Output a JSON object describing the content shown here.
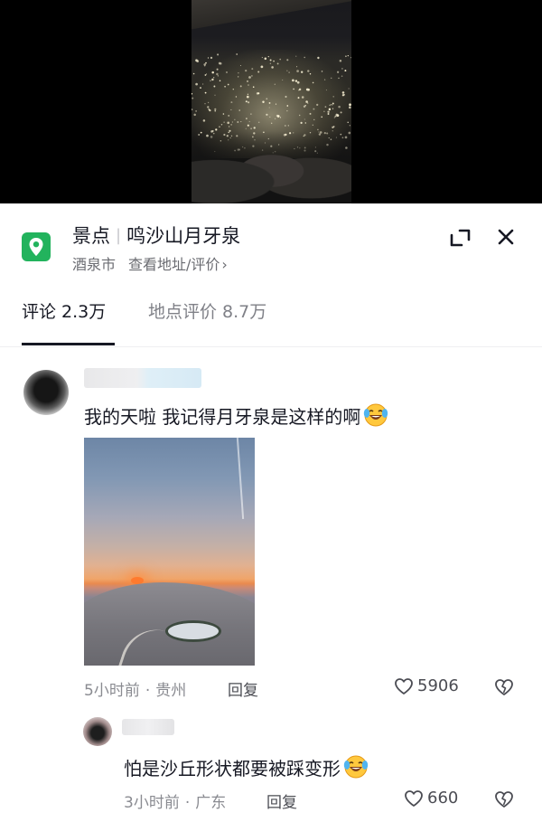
{
  "location": {
    "category": "景点",
    "name": "鸣沙山月牙泉",
    "city": "酒泉市",
    "link": "查看地址/评价",
    "chevron": "›"
  },
  "icons": {
    "location": "map-pin-icon",
    "expand": "expand-icon",
    "close": "close-icon",
    "like": "heart-outline-icon",
    "dislike": "broken-heart-icon",
    "emoji": "laughing-tears-emoji"
  },
  "tabs": [
    {
      "label": "评论 2.3万",
      "active": true
    },
    {
      "label": "地点评价 8.7万",
      "active": false
    }
  ],
  "comments": [
    {
      "text": "我的天啦 我记得月牙泉是这样的啊",
      "time": "5小时前",
      "dot": "·",
      "region": "贵州",
      "reply_label": "回复",
      "likes": "5906"
    },
    {
      "text": "怕是沙丘形状都要被踩变形",
      "time": "3小时前",
      "dot": "·",
      "region": "广东",
      "reply_label": "回复",
      "likes": "660"
    }
  ],
  "colors": {
    "accent_green": "#22b35d",
    "text_primary": "#161823",
    "text_secondary": "#8a8b91"
  }
}
